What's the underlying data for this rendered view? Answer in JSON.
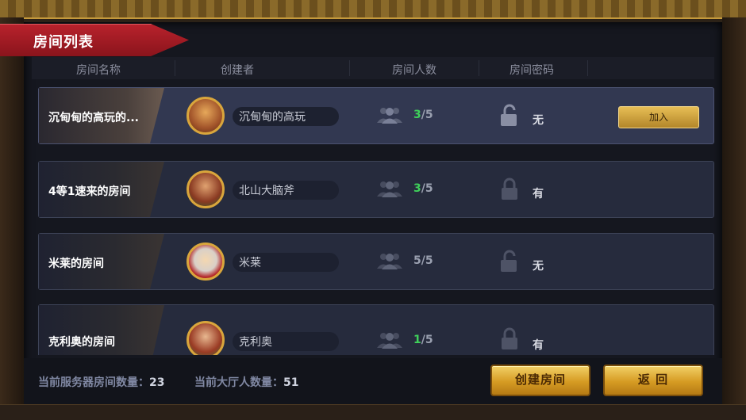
{
  "window": {
    "title": "房间列表"
  },
  "columns": [
    "房间名称",
    "创建者",
    "房间人数",
    "房间密码"
  ],
  "rooms": [
    {
      "name": "沉甸甸的高玩的...",
      "creator": "沉甸甸的高玩",
      "current": "3",
      "max": "/5",
      "password": "无",
      "join_label": "加入",
      "avatar": "orange-haired-warrior-avatar",
      "locked": false
    },
    {
      "name": "4等1速来的房间",
      "creator": "北山大脑斧",
      "current": "3",
      "max": "/5",
      "password": "有",
      "avatar": "red-haired-woman-avatar",
      "locked": true
    },
    {
      "name": "米莱的房间",
      "creator": "米莱",
      "current": "5",
      "max": "/5",
      "password": "无",
      "avatar": "santa-avatar",
      "locked": false
    },
    {
      "name": "克利奥的房间",
      "creator": "克利奥",
      "current": "1",
      "max": "/5",
      "password": "有",
      "avatar": "red-haired-woman-avatar",
      "locked": true
    }
  ],
  "footer": {
    "server_rooms_label": "当前服务器房间数量：",
    "server_rooms_value": "23",
    "lobby_people_label": "当前大厅人数量：",
    "lobby_people_value": "51",
    "create_button": "创建房间",
    "back_button": "返 回"
  },
  "colors": {
    "accent_gold": "#d69b23",
    "ribbon_red": "#b8222c",
    "count_green": "#3fd05a"
  }
}
